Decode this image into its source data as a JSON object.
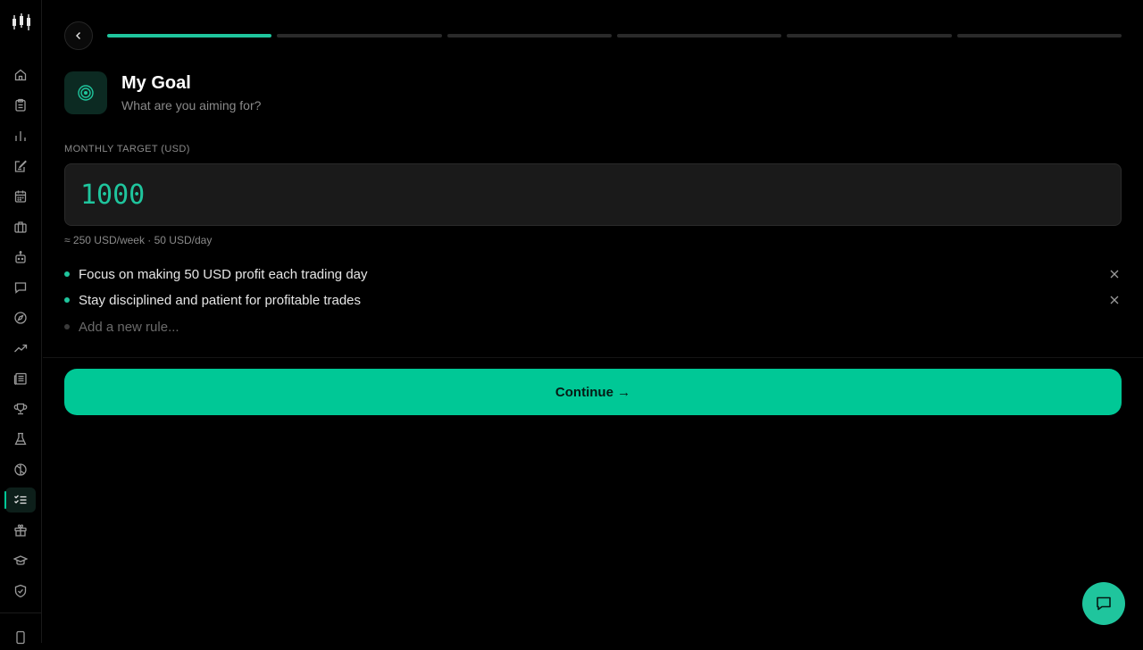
{
  "sidebar": {
    "items": [
      {
        "icon": "home-icon"
      },
      {
        "icon": "clipboard-icon"
      },
      {
        "icon": "bar-chart-icon"
      },
      {
        "icon": "journal-edit-icon"
      },
      {
        "icon": "calendar-icon"
      },
      {
        "icon": "briefcase-icon"
      },
      {
        "icon": "robot-icon"
      },
      {
        "icon": "message-icon"
      },
      {
        "icon": "compass-icon"
      },
      {
        "icon": "trending-up-icon"
      },
      {
        "icon": "newspaper-icon"
      },
      {
        "icon": "trophy-icon"
      },
      {
        "icon": "flask-icon"
      },
      {
        "icon": "brain-icon"
      },
      {
        "icon": "checklist-icon",
        "active": true
      },
      {
        "icon": "gift-icon"
      },
      {
        "icon": "graduation-cap-icon"
      },
      {
        "icon": "shield-check-icon"
      },
      {
        "icon": "phone-icon"
      }
    ]
  },
  "progress": {
    "total_steps": 6,
    "current_step": 1
  },
  "header": {
    "title": "My Goal",
    "subtitle": "What are you aiming for?"
  },
  "target": {
    "label": "Monthly target (USD)",
    "value": "1000",
    "hint": "≈ 250 USD/week · 50 USD/day"
  },
  "rules": {
    "items": [
      {
        "text": "Focus on making 50 USD profit each trading day"
      },
      {
        "text": "Stay disciplined and patient for profitable trades"
      }
    ],
    "new_placeholder": "Add a new rule..."
  },
  "continue_label": "Continue →",
  "colors": {
    "accent": "#00c896",
    "background": "#000000",
    "input_bg": "#1a1a1a"
  }
}
